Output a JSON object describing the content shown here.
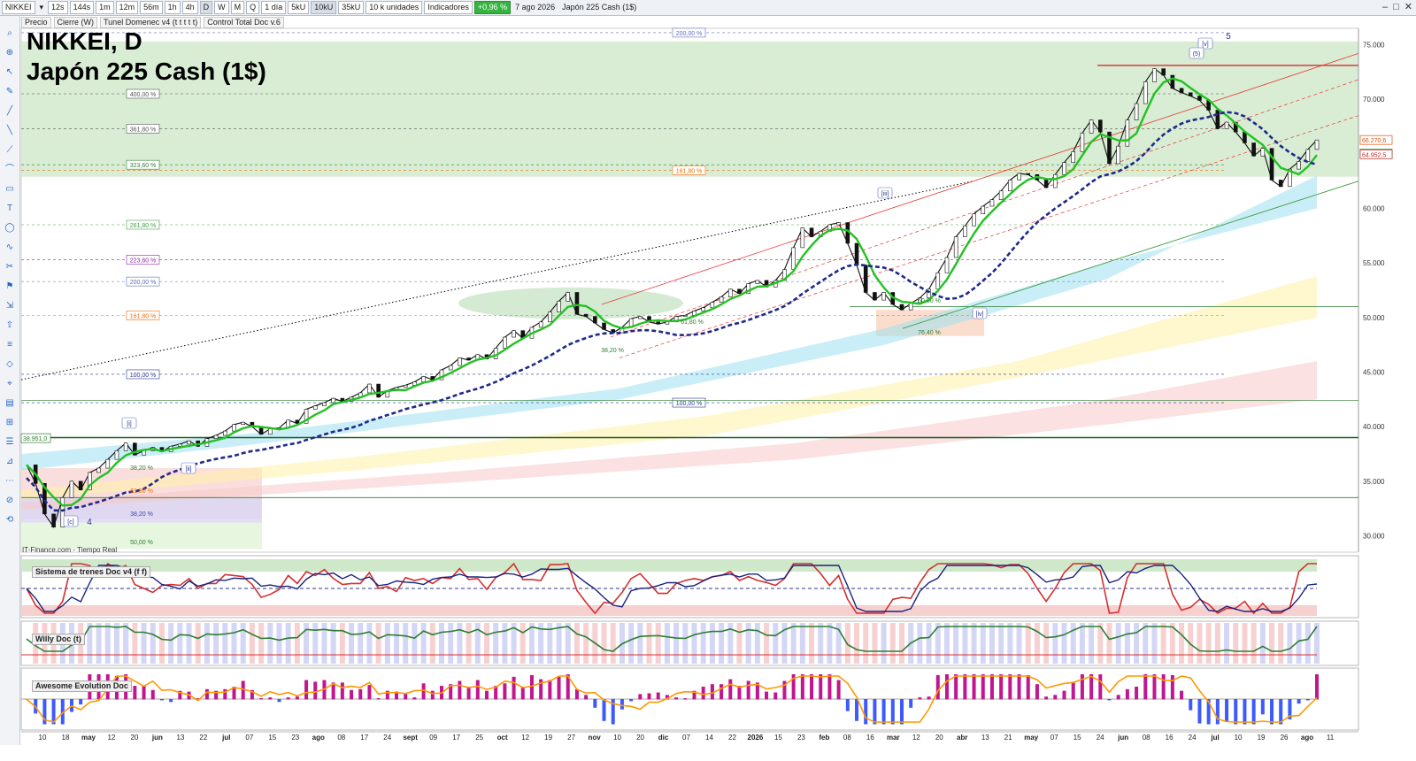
{
  "toolbar": {
    "symbol": "NIKKEI",
    "timeframes": [
      "12s",
      "144s",
      "1m",
      "12m",
      "56m",
      "1h",
      "4h",
      "D",
      "W",
      "M",
      "Q"
    ],
    "active_timeframe": "D",
    "period": "1 día",
    "units": [
      "5kU",
      "10kU",
      "35kU"
    ],
    "active_unit": "10kU",
    "units_menu": "10 k unidades",
    "indicators": "Indicadores",
    "change": "+0,96 %",
    "date": "7 ago 2026",
    "instrument": "Japón 225 Cash (1$)"
  },
  "subbar": [
    "Precio",
    "Cierre (W)",
    "Tunel Domenec v4 (t t t t t)",
    "Control Total Doc v.6"
  ],
  "title_line1": "NIKKEI, D",
  "title_line2": "Japón 225 Cash (1$)",
  "source": "IT-Finance.com - Tiempo Real",
  "panels": {
    "p1": "Sistema de trenes Doc v4 (f f)",
    "p2": "Willy Doc (t)",
    "p3": "Awesome Evolution Doc"
  },
  "chart_data": {
    "type": "line",
    "title": "NIKKEI, D",
    "subtitle": "Japón 225 Cash (1$)",
    "ylim": [
      28500,
      76500
    ],
    "yticks": [
      30000,
      35000,
      40000,
      45000,
      50000,
      55000,
      60000,
      65000,
      70000,
      75000
    ],
    "ytick_labels": [
      "30.000",
      "35.000",
      "40.000",
      "45.000",
      "50.000",
      "55.000",
      "60.000",
      "65.000",
      "70.000",
      "75.000"
    ],
    "x_labels": [
      "10",
      "18",
      "may",
      "12",
      "20",
      "jun",
      "13",
      "22",
      "jul",
      "07",
      "15",
      "23",
      "ago",
      "08",
      "17",
      "24",
      "sept",
      "09",
      "17",
      "25",
      "oct",
      "12",
      "19",
      "27",
      "nov",
      "10",
      "20",
      "dic",
      "07",
      "14",
      "22",
      "2026",
      "15",
      "23",
      "feb",
      "08",
      "16",
      "mar",
      "12",
      "20",
      "abr",
      "13",
      "21",
      "may",
      "07",
      "15",
      "24",
      "jun",
      "08",
      "16",
      "24",
      "jul",
      "10",
      "19",
      "26",
      "ago",
      "11"
    ],
    "price_labels": [
      {
        "text": "66.270,6",
        "value": 66270,
        "color": "#d9530f"
      },
      {
        "text": "65.016,4",
        "value": 65016,
        "color": "#2e7d32"
      },
      {
        "text": "64.952,5",
        "value": 64952,
        "color": "#c62828"
      },
      {
        "text": "38.951,0",
        "value": 38951,
        "color": "#2e7d32"
      }
    ],
    "fib_labels": [
      {
        "text": "200,00 %",
        "value": 76100,
        "pos": "top",
        "color": "#5c6bc0"
      },
      {
        "text": "400,00 %",
        "value": 70500,
        "pos": "left",
        "color": "#555"
      },
      {
        "text": "361,80 %",
        "value": 67300,
        "pos": "left",
        "color": "#555"
      },
      {
        "text": "323,60 %",
        "value": 64000,
        "pos": "left",
        "color": "#2e7d32"
      },
      {
        "text": "161,80 %",
        "value": 63500,
        "pos": "mid",
        "color": "#ef6c00"
      },
      {
        "text": "261,80 %",
        "value": 58500,
        "pos": "left",
        "color": "#43a047"
      },
      {
        "text": "223,60 %",
        "value": 55300,
        "pos": "left",
        "color": "#8e24aa"
      },
      {
        "text": "200,00 %",
        "value": 53300,
        "pos": "left",
        "color": "#5c6bc0"
      },
      {
        "text": "161,80 %",
        "value": 50200,
        "pos": "left",
        "color": "#ef6c00"
      },
      {
        "text": "100,00 %",
        "value": 44800,
        "pos": "left",
        "color": "#283593"
      },
      {
        "text": "100,00 %",
        "value": 42200,
        "pos": "mid",
        "color": "#283593"
      }
    ],
    "wave_labels": [
      "5",
      "[v]",
      "(5)",
      "[iii]",
      "[iv]",
      "[i]",
      "[ii]",
      "[c]",
      "4"
    ],
    "small_fibs": [
      "38,20 %",
      "61,80 %",
      "38,20 %",
      "50,00 %",
      "38,20 %",
      "50,00 %",
      "61,80 %",
      "76,40 %"
    ],
    "series": [
      {
        "name": "",
        "values": [
          36500,
          34800,
          32000,
          30800,
          33500,
          35000,
          34200,
          35800,
          36200,
          37000,
          37800,
          38500,
          37400,
          37800,
          38100,
          37700,
          38200,
          38400,
          38700,
          38200,
          38900,
          39200,
          39600,
          40200,
          40400,
          40000,
          39300,
          39800,
          39900,
          40600,
          40300,
          41600,
          41900,
          42200,
          42600,
          42300,
          42700,
          43100,
          43900,
          42700,
          43300,
          43600,
          43800,
          44100,
          44600,
          44300,
          45200,
          45600,
          46300,
          46100,
          46600,
          46200,
          47200,
          48200,
          48800,
          48100,
          49100,
          49600,
          50500,
          51500,
          52300,
          50300,
          50100,
          49500,
          48900,
          48600,
          49100,
          49900,
          50100,
          49600,
          49400,
          49600,
          50100,
          50200,
          50600,
          50900,
          51400,
          51900,
          52600,
          52200,
          53100,
          53400,
          52800,
          53400,
          54400,
          56400,
          58200,
          57400,
          57900,
          58500,
          58700,
          56800,
          54800,
          52300,
          51600,
          52300,
          51200,
          50700,
          51300,
          51800,
          52600,
          54100,
          55500,
          57400,
          58400,
          59500,
          60200,
          60800,
          61600,
          62600,
          63200,
          63100,
          62600,
          61900,
          63100,
          64200,
          65200,
          66900,
          68100,
          67000,
          64100,
          65700,
          68100,
          69600,
          71600,
          72800,
          72200,
          71000,
          70600,
          70300,
          69900,
          69000,
          67300,
          67900,
          67000,
          66000,
          64800,
          65500,
          62600,
          62000,
          63600,
          64300,
          65400,
          66270
        ]
      }
    ]
  }
}
